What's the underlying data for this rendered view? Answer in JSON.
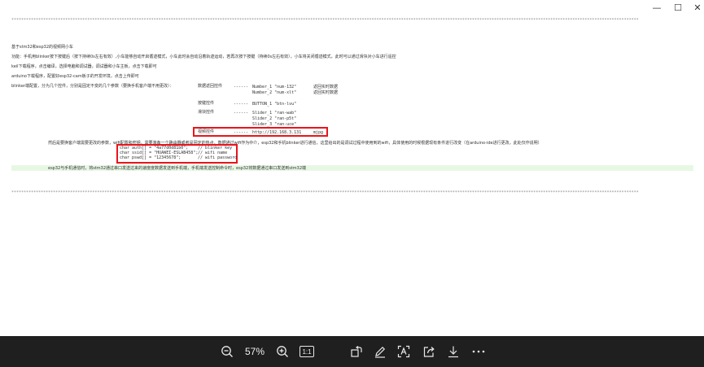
{
  "window": {
    "minimize_glyph": "—",
    "maximize_glyph": "☐",
    "close_glyph": "✕"
  },
  "document": {
    "rule_chars": "****************************************************************************************************************************************************************************************************************************************************************",
    "title": "基于stm32和esp32的视频网小车",
    "function_desc": "功能：手机用blinker按下按键后（按下持续0s左右有效）,小车能够自动开启循迹模式，小车此时会自动沿着轨迹运动，若再次按下按键（持续0s左右有效），小车将关闭循迹模式，此时可以通过滑块对小车进行遥控",
    "keil_line": "keil下载程序，点击编译，选择电脑和调试器，调试器和小车主板，点击下载即可",
    "arduino_line": "arduino下载程序，配置好esp32-cam板子的开发环境，点击上传即可",
    "blinker_config": "blinker端配置，分为几个控件，分别是固定不变的几个参数（要换手机客户端不用更改）：",
    "components": [
      {
        "label": "数据返回控件",
        "dash": "------",
        "values": [
          "Number_1 \"num-132\"",
          "Number_2 \"num-xlt\""
        ],
        "notes": [
          "返回实时数据",
          "返回实时数据"
        ]
      },
      {
        "label": "按键控件",
        "dash": "------",
        "values": [
          "BUTTON_1 \"btn-lvu\""
        ],
        "notes": []
      },
      {
        "label": "滑块控件",
        "dash": "------",
        "values": [
          "Slider_1 \"ran-wab\"",
          "Slider_2 \"ran-p5t\"",
          "Slider_3 \"ran-uce\""
        ],
        "notes": []
      },
      {
        "label": "视频控件",
        "dash": "------",
        "values": [
          "http://192.168.3.131"
        ],
        "notes": [
          "mjpg"
        ]
      }
    ],
    "network_desc": "然后是要换客户端需要更改的参数，wifi配置和密钥，需要准备一个路由器或者是固定的热点，数据通过wifi作为中介，esp32和手机blinker进行通信，这里给出的是调试过程中使用到的wifi，具体使用的时候根据现有条件进行改变（在arduino-ide进行更改，此处仅作说明）",
    "code_lines": [
      {
        "code": "char auth[] = \"4a77d0d81b0\";",
        "comment": "// blinker key"
      },
      {
        "code": "char ssid[] = \"HUAWEI-ESLAB458\";",
        "comment": "// wifi name"
      },
      {
        "code": "char pswd[] = \"12345678\";",
        "comment": "// wifi password"
      }
    ],
    "comm_desc": "esp32与手机通信时，将stm32通过串口发送过来的速度度数据发送到手机端，手机端发送控制命令时，esp32将数据通过串口发送到stm32端"
  },
  "toolbar": {
    "zoom_level": "57%",
    "actual_size_label": "1:1"
  },
  "colors": {
    "highlight_box": "#e8151b",
    "highlight_row": "#e6f8e3",
    "toolbar_bg": "#1f1f1f"
  }
}
